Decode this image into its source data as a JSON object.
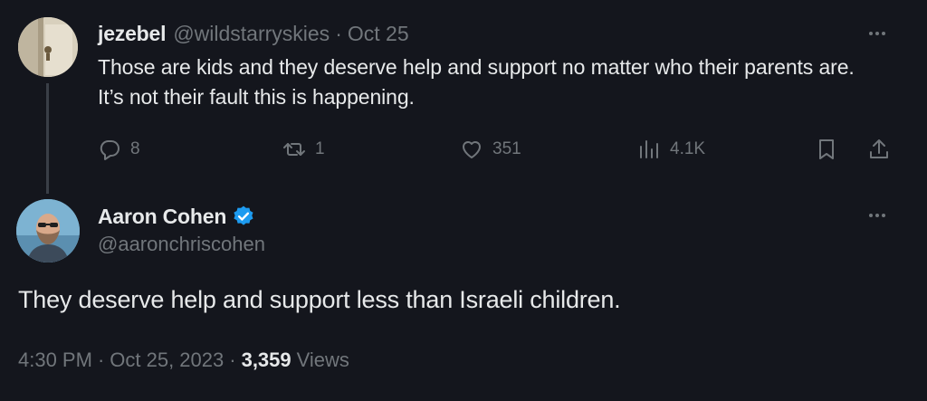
{
  "reply": {
    "display_name": "jezebel",
    "handle": "@wildstarryskies",
    "separator": "·",
    "date": "Oct 25",
    "text": "Those are kids and they deserve help and support no matter who their parents are. It’s not their fault this is happening.",
    "actions": {
      "replies": "8",
      "reposts": "1",
      "likes": "351",
      "views": "4.1K"
    }
  },
  "main_tweet": {
    "display_name": "Aaron Cohen",
    "handle": "@aaronchriscohen",
    "verified": true,
    "text": "They deserve help and support less than Israeli children.",
    "time": "4:30 PM",
    "separator_1": "·",
    "date": "Oct 25, 2023",
    "separator_2": "·",
    "views_count": "3,359",
    "views_label": "Views"
  },
  "colors": {
    "background": "#14161d",
    "text_primary": "#e7e9ea",
    "text_muted": "#71767b",
    "verified_badge": "#1d9bf0"
  },
  "icons": {
    "reply": "reply-icon",
    "repost": "repost-icon",
    "like": "heart-icon",
    "views": "views-bar-chart-icon",
    "bookmark": "bookmark-icon",
    "share": "share-icon",
    "more": "more-options-icon",
    "verified": "verified-badge-icon"
  }
}
